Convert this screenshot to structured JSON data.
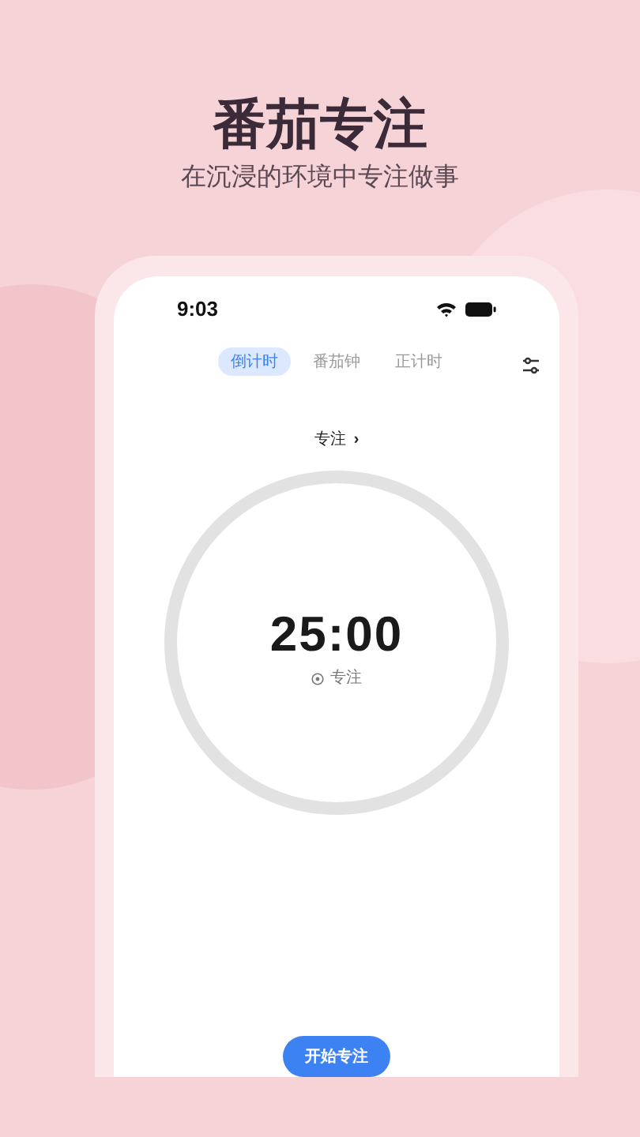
{
  "headline": {
    "title": "番茄专注",
    "subtitle": "在沉浸的环境中专注做事"
  },
  "status_bar": {
    "time": "9:03"
  },
  "tabs": [
    {
      "label": "倒计时",
      "selected": true
    },
    {
      "label": "番茄钟",
      "selected": false
    },
    {
      "label": "正计时",
      "selected": false
    }
  ],
  "focus_selector": {
    "label": "专注",
    "chevron": "›"
  },
  "timer": {
    "time": "25:00",
    "mode": "专注"
  },
  "start_button": {
    "label": "开始专注"
  }
}
